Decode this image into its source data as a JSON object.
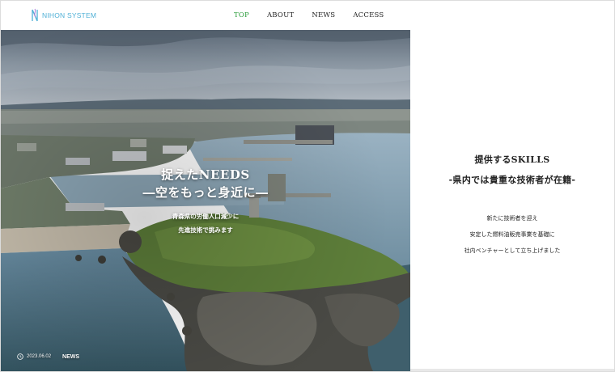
{
  "header": {
    "logo_text": "NIHON SYSTEM",
    "nav": [
      {
        "label": "TOP",
        "active": true
      },
      {
        "label": "ABOUT",
        "active": false
      },
      {
        "label": "NEWS",
        "active": false
      },
      {
        "label": "ACCESS",
        "active": false
      }
    ]
  },
  "hero": {
    "title_line1": "捉えたNEEDS",
    "title_line2": "―空をもっと身近に―",
    "sub_line1": "青森県の労働人口減少に",
    "sub_line2": "先進技術で挑みます",
    "news_date": "2023.06.02",
    "news_label": "NEWS"
  },
  "panel": {
    "skills_title": "提供するSKILLS",
    "skills_sub": "-県内では貴重な技術者が在籍-",
    "body": [
      "新たに技術者を迎え",
      "安定した燃料油販売事業を基礎に",
      "社内ベンチャーとして立ち上げました"
    ]
  },
  "colors": {
    "nav_active": "#2e9e3e",
    "logo": "#4fb0d6"
  }
}
